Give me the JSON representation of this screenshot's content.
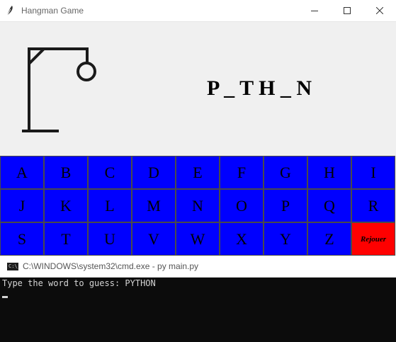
{
  "window": {
    "title": "Hangman Game",
    "icon": "feather-icon",
    "controls": [
      "minimize-icon",
      "maximize-icon",
      "close-icon"
    ]
  },
  "game": {
    "word_display": "P _ T H _ N",
    "letters": [
      "A",
      "B",
      "C",
      "D",
      "E",
      "F",
      "G",
      "H",
      "I",
      "J",
      "K",
      "L",
      "M",
      "N",
      "O",
      "P",
      "Q",
      "R",
      "S",
      "T",
      "U",
      "V",
      "W",
      "X",
      "Y",
      "Z"
    ],
    "replay_label": "Rejouer",
    "colors": {
      "letter_button": "#0000ff",
      "replay_button": "#ff0000",
      "background": "#f0f0f0"
    }
  },
  "console": {
    "title": "C:\\WINDOWS\\system32\\cmd.exe - py  main.py",
    "icon_text": "C:\\_",
    "output_line": "Type the word to guess: PYTHON"
  }
}
